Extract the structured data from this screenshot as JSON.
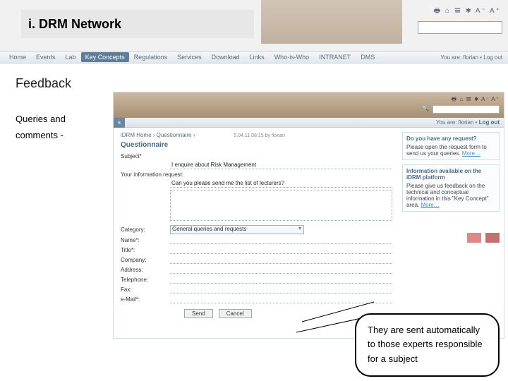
{
  "slide": {
    "title": "i. DRM Network",
    "section": "Feedback",
    "subtitle1": "Queries and",
    "subtitle2": "comments -",
    "callout": "They are sent automatically to those experts responsible for a subject",
    "acc_icons": "🖶 ⌂ ☰ ✱  A⁻  A⁺"
  },
  "main_nav": {
    "items": [
      "Home",
      "Events",
      "Lab",
      "Key Concepts",
      "Regulations",
      "Services",
      "Download",
      "Links",
      "Who-is-Who",
      "INTRANET",
      "DMS"
    ],
    "active_index": 3,
    "logout": "You are: florian • Log out"
  },
  "inner": {
    "acc_icons": "🖶 ⌂ ☰ ✱  A⁻  A⁺",
    "search_icon": "🔍",
    "nav_tab": "s",
    "status": "You are: florian • ",
    "status_link": "Log out",
    "breadcrumb": "iDRM Home › Questionnaire ›",
    "title": "Questionnaire",
    "date": "5.04.11 08:15\nby florian",
    "fields": {
      "subject_label": "Subject*",
      "subject_value": "I enquire about Risk Management",
      "request_label": "Your information request:",
      "request_value": "Can you please send me the list of lecturers?",
      "category_label": "Category:",
      "category_value": "General queries and requests",
      "name_label": "Name*:",
      "title_label": "Title*:",
      "company_label": "Company:",
      "address_label": "Address:",
      "telephone_label": "Telephone:",
      "fax_label": "Fax:",
      "email_label": "e-Mail*:"
    },
    "buttons": {
      "send": "Send",
      "cancel": "Cancel"
    },
    "sidebar": {
      "box1_title": "Do you have any request?",
      "box1_body": "Please open the request form to send us your queries. ",
      "box1_more": "More…",
      "box2_title": "Information available on the iDRM platform",
      "box2_body": "Please give us feedback on the technical and conceptual information in this \"Key Concept\" area. ",
      "box2_more": "More…"
    }
  }
}
